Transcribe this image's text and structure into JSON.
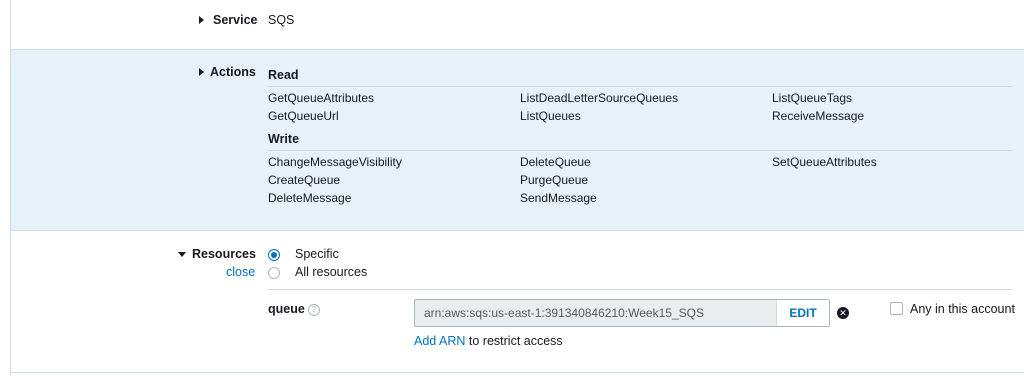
{
  "service": {
    "label": "Service",
    "value": "SQS"
  },
  "actions": {
    "label": "Actions",
    "groups": [
      {
        "name": "Read",
        "columns": [
          [
            "GetQueueAttributes",
            "GetQueueUrl"
          ],
          [
            "ListDeadLetterSourceQueues",
            "ListQueues"
          ],
          [
            "ListQueueTags",
            "ReceiveMessage"
          ]
        ]
      },
      {
        "name": "Write",
        "columns": [
          [
            "ChangeMessageVisibility",
            "CreateQueue",
            "DeleteMessage"
          ],
          [
            "DeleteQueue",
            "PurgeQueue",
            "SendMessage"
          ],
          [
            "SetQueueAttributes"
          ]
        ]
      }
    ]
  },
  "resources": {
    "label": "Resources",
    "close": "close",
    "options": [
      {
        "label": "Specific",
        "checked": true
      },
      {
        "label": "All resources",
        "checked": false
      }
    ],
    "queue": {
      "label": "queue",
      "help_icon": "question-circle-icon",
      "arn": "arn:aws:sqs:us-east-1:391340846210:Week15_SQS",
      "edit": "EDIT",
      "remove_icon": "x-circle-icon",
      "any_account": "Any in this account",
      "add_arn_link": "Add ARN",
      "add_arn_rest": " to restrict access"
    }
  },
  "colors": {
    "accent": "#0073bb",
    "actions_bg": "#e6f1fa",
    "border": "#d5dbdb"
  }
}
